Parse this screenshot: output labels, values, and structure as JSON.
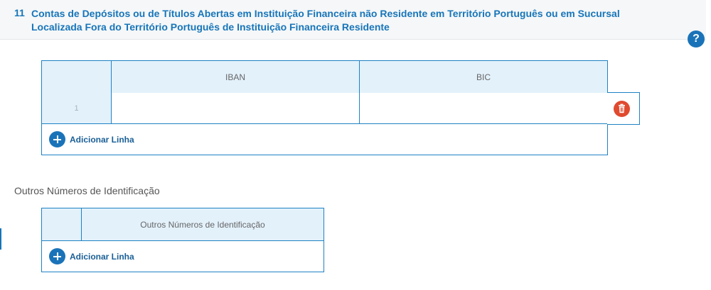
{
  "section": {
    "number": "11",
    "title": "Contas de Depósitos ou de Títulos Abertas em Instituição Financeira não Residente em Território Português ou em Sucursal Localizada Fora do Território Português de Instituição Financeira Residente"
  },
  "help_icon": {
    "label": "?",
    "icon": "help-icon"
  },
  "accounts_table": {
    "columns": [
      "IBAN",
      "BIC"
    ],
    "rows": [
      {
        "number": "1",
        "iban": "",
        "bic": ""
      }
    ],
    "add_label": "Adicionar Linha",
    "delete_icon": "trash-icon"
  },
  "other_ids": {
    "heading": "Outros Números de Identificação",
    "columns": [
      "Outros Números de Identificação"
    ],
    "add_label": "Adicionar Linha"
  },
  "colors": {
    "accent": "#1775b9",
    "header_bg": "#e3f1fb",
    "delete": "#e04a2f"
  }
}
